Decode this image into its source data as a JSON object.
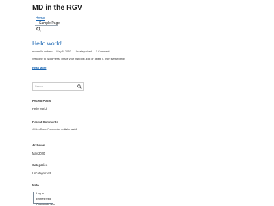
{
  "header": {
    "site_title": "MD in the RGV",
    "nav": {
      "home": "Home",
      "sample_page": "Sample Page"
    }
  },
  "post": {
    "title": "Hello world!",
    "meta": {
      "author": "escamilla.andrew",
      "date": "May 6, 2020",
      "category": "Uncategorized",
      "comments": "1 Comment"
    },
    "excerpt": "Welcome to WordPress. This is your first post. Edit or delete it, then start writing!",
    "read_more": "Read More"
  },
  "sidebar": {
    "search_placeholder": "Search",
    "recent_posts": {
      "title": "Recent Posts",
      "items": [
        "Hello world!"
      ]
    },
    "recent_comments": {
      "title": "Recent Comments",
      "author": "A WordPress Commenter",
      "on": "on",
      "post": "Hello world!"
    },
    "archives": {
      "title": "Archives",
      "items": [
        "May 2020"
      ]
    },
    "categories": {
      "title": "Categories",
      "items": [
        "Uncategorized"
      ]
    },
    "meta": {
      "title": "Meta",
      "items": [
        "Log in",
        "Entries feed",
        "Comments feed"
      ]
    }
  },
  "colors": {
    "link": "#1a66b3",
    "text": "#222222",
    "muted": "#555555"
  }
}
